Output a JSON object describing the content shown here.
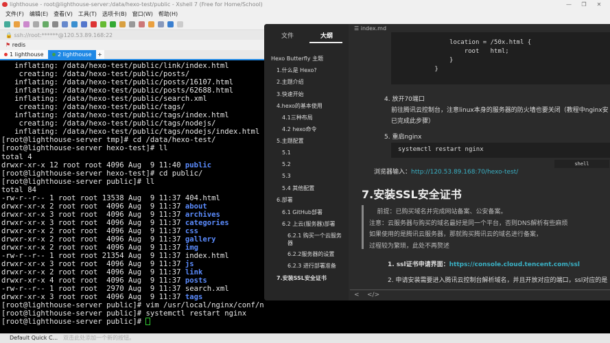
{
  "window": {
    "title": "lighthouse - root@lighthouse-server:/data/hexo-test/public - Xshell 7 (Free for Home/School)",
    "minimize": "—",
    "maximize": "❐",
    "close": "✕"
  },
  "menu": [
    "文件(F)",
    "编辑(E)",
    "查看(V)",
    "工具(T)",
    "选项卡(B)",
    "窗口(W)",
    "帮助(H)"
  ],
  "address": "ssh://root:******@120.53.89.168:22",
  "links_bar": {
    "item": "redis"
  },
  "tabs": [
    {
      "label": "1 lighthouse",
      "dot": "#e53935",
      "active": false
    },
    {
      "label": "2 lighthouse",
      "dot": "#43a047",
      "active": true
    }
  ],
  "tab_add": "+",
  "terminal": {
    "lines": [
      "   inflating: /data/hexo-test/public/link/index.html",
      "    creating: /data/hexo-test/public/posts/",
      "   inflating: /data/hexo-test/public/posts/16107.html",
      "   inflating: /data/hexo-test/public/posts/62688.html",
      "   inflating: /data/hexo-test/public/search.xml",
      "    creating: /data/hexo-test/public/tags/",
      "   inflating: /data/hexo-test/public/tags/index.html",
      "    creating: /data/hexo-test/public/tags/nodejs/",
      "   inflating: /data/hexo-test/public/tags/nodejs/index.html",
      "[root@lighthouse-server tmp]# cd /data/hexo-test/",
      "[root@lighthouse-server hexo-test]# ll",
      "total 4",
      "drwxr-xr-x 12 root root 4096 Aug  9 11:40 |public",
      "[root@lighthouse-server hexo-test]# cd public/",
      "[root@lighthouse-server public]# ll",
      "total 84",
      "-rw-r--r-- 1 root root 13538 Aug  9 11:37 404.html",
      "drwxr-xr-x 2 root root  4096 Aug  9 11:37 |about",
      "drwxr-xr-x 3 root root  4096 Aug  9 11:37 |archives",
      "drwxr-xr-x 3 root root  4096 Aug  9 11:37 |categories",
      "drwxr-xr-x 2 root root  4096 Aug  9 11:37 |css",
      "drwxr-xr-x 2 root root  4096 Aug  9 11:37 |gallery",
      "drwxr-xr-x 2 root root  4096 Aug  9 11:37 |img",
      "-rw-r--r-- 1 root root 21354 Aug  9 11:37 index.html",
      "drwxr-xr-x 3 root root  4096 Aug  9 11:37 |js",
      "drwxr-xr-x 2 root root  4096 Aug  9 11:37 |link",
      "drwxr-xr-x 4 root root  4096 Aug  9 11:37 |posts",
      "-rw-r--r-- 1 root root  2970 Aug  9 11:37 search.xml",
      "drwxr-xr-x 3 root root  4096 Aug  9 11:37 |tags",
      "[root@lighthouse-server public]# vim /usr/local/nginx/conf/nginx.conf",
      "[root@lighthouse-server public]# systemctl restart nginx",
      "[root@lighthouse-server public]# "
    ]
  },
  "status": {
    "label": "Default Quick C...",
    "hint": "双击此处添加一个新的按钮。"
  },
  "typora": {
    "side_tabs": [
      "文件",
      "大纲"
    ],
    "outline": [
      {
        "t": "Hexo Butterfly 主题",
        "l": 0
      },
      {
        "t": "1.什么是 Hexo?",
        "l": 1
      },
      {
        "t": "2.主题介绍",
        "l": 1
      },
      {
        "t": "3.快速开始",
        "l": 1
      },
      {
        "t": "4.hexo的基本使用",
        "l": 1
      },
      {
        "t": "4.1三种布局",
        "l": 2
      },
      {
        "t": "4.2 hexo命令",
        "l": 2
      },
      {
        "t": "5.主题配置",
        "l": 1
      },
      {
        "t": "5.1",
        "l": 2
      },
      {
        "t": "5.2",
        "l": 2
      },
      {
        "t": "5.3",
        "l": 2
      },
      {
        "t": "5.4 其他配置",
        "l": 2
      },
      {
        "t": "6.部署",
        "l": 1
      },
      {
        "t": "6.1 GitHub部署",
        "l": 2
      },
      {
        "t": "6.2 上云(服务器)部署",
        "l": 2
      },
      {
        "t": "6.2.1 购买一个云服务器",
        "l": 3
      },
      {
        "t": "6.2.2服务器的设置",
        "l": 3
      },
      {
        "t": "6.2.3 进行部署准备",
        "l": 3
      },
      {
        "t": "7.安装SSL安全证书",
        "l": 1
      }
    ],
    "file": "index.md",
    "code1": "            location = /50x.html {\n                root   html;\n            }\n        }",
    "step4": "4. 放开70端口",
    "step4_text1": "前往腾讯云控制台，注意linux本身的服务器的防火墙也要关闭（教程中nginx安",
    "step4_text2": "已完成此步骤）",
    "step5": "5. 重启nginx",
    "code2": "systemctl restart nginx",
    "code2_lang": "shell",
    "browser_label": "浏览器输入：",
    "browser_url": "http://120.53.89.168:70/hexo-test/",
    "h2": "7.安装SSL安全证书",
    "quote": [
      "    前提：已购买域名并完成网站备案、公安备案。",
      "注意：云服务器与购买的域名最好是同一个平台，否则DNS解析有些麻烦",
      "如果使用的是腾讯云服务器，那就购买腾讯云的域名进行备案，",
      "过程较为繁琐，此处不再赘述"
    ],
    "ssl1_label": "1. ssl证书申请界面：",
    "ssl1_url": "https://console.cloud.tencent.com/ssl",
    "ssl2": "2. 申请安装需要进入腾讯云控制台解析域名，并且开放对应的端口，ssl对应的是",
    "footer_back": "<",
    "footer_source": "</>"
  }
}
